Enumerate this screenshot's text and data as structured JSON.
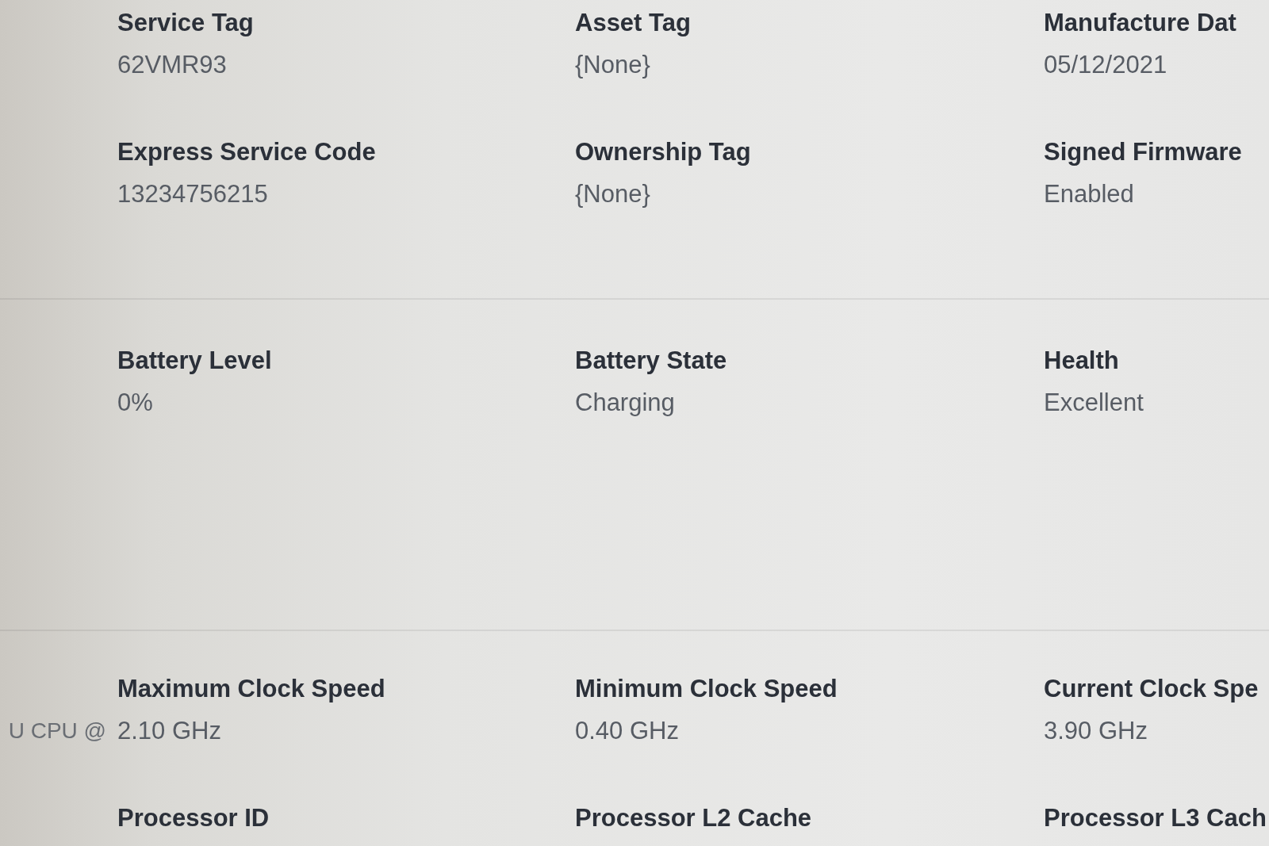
{
  "sections": [
    {
      "fields": [
        {
          "label": "Service Tag",
          "value": "62VMR93"
        },
        {
          "label": "Asset Tag",
          "value": "{None}"
        },
        {
          "label": "Manufacture Dat",
          "value": "05/12/2021"
        },
        {
          "label": "Express Service Code",
          "value": "13234756215"
        },
        {
          "label": "Ownership Tag",
          "value": "{None}"
        },
        {
          "label": "Signed Firmware",
          "value": "Enabled"
        }
      ]
    },
    {
      "fields": [
        {
          "label": "Battery Level",
          "value": "0%"
        },
        {
          "label": "Battery State",
          "value": "Charging"
        },
        {
          "label": "Health",
          "value": "Excellent"
        }
      ]
    },
    {
      "leading_value": "U CPU @",
      "fields": [
        {
          "label": "Maximum Clock Speed",
          "value": "2.10 GHz"
        },
        {
          "label": "Minimum Clock Speed",
          "value": "0.40 GHz"
        },
        {
          "label": "Current Clock Spe",
          "value": "3.90 GHz"
        },
        {
          "label": "Processor ID"
        },
        {
          "label": "Processor L2 Cache"
        },
        {
          "label": "Processor L3 Cach"
        }
      ]
    }
  ]
}
